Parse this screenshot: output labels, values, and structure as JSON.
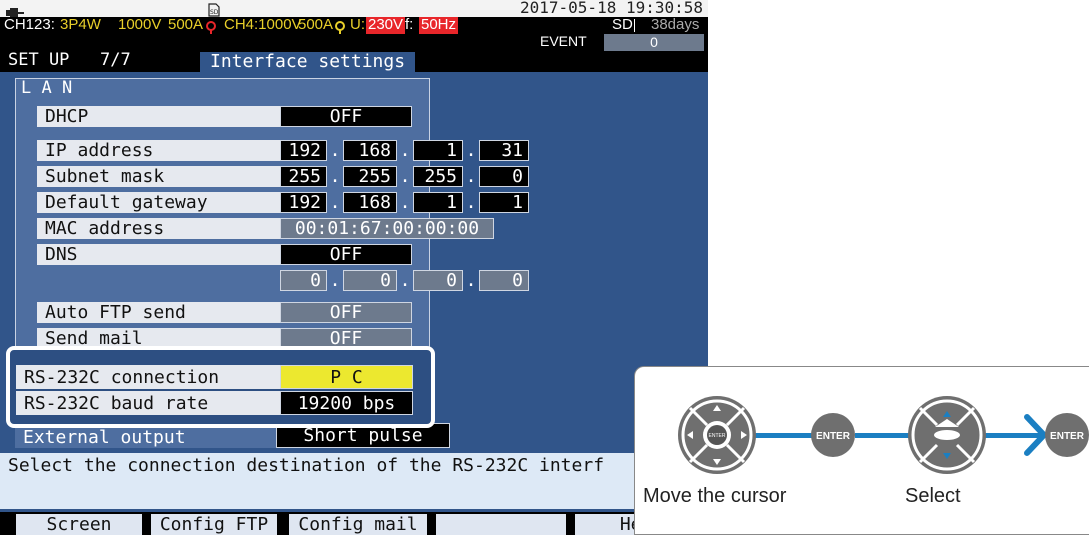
{
  "status": {
    "datetime": "2017-05-18 19:30:58",
    "ch123": "CH123:",
    "wiring": "3P4W",
    "voltage_range": "1000V",
    "current_range": "500A",
    "ch4": "CH4:1000V",
    "ch4_current": "500A",
    "u_label": "U:",
    "u_value": "230V",
    "f_label": "f:",
    "f_value": "50Hz",
    "sd": "SD",
    "days": "38days",
    "event": "EVENT",
    "event_count": "0",
    "colors": {
      "accent_red": "#e8262a",
      "warning_yellow": "#e8cf2a"
    }
  },
  "title": {
    "menu": "SET UP",
    "page": "7/7",
    "name": "Interface settings"
  },
  "lan": {
    "header": "L A N",
    "dhcp": {
      "label": "DHCP",
      "value": "OFF"
    },
    "ip": {
      "label": "IP address",
      "octets": [
        "192",
        "168",
        "1",
        "31"
      ]
    },
    "subnet": {
      "label": "Subnet mask",
      "octets": [
        "255",
        "255",
        "255",
        "0"
      ]
    },
    "gateway": {
      "label": "Default gateway",
      "octets": [
        "192",
        "168",
        "1",
        "1"
      ]
    },
    "mac": {
      "label": "MAC address",
      "value": "00:01:67:00:00:00"
    },
    "dns": {
      "label": "DNS",
      "value": "OFF",
      "octets": [
        "0",
        "0",
        "0",
        "0"
      ]
    },
    "ftp": {
      "label": "Auto FTP send",
      "value": "OFF"
    },
    "mail": {
      "label": "Send mail",
      "value": "OFF"
    }
  },
  "rs232": {
    "connection": {
      "label": "RS-232C connection",
      "value": "P C"
    },
    "baud": {
      "label": "RS-232C baud rate",
      "value": "19200 bps"
    }
  },
  "external": {
    "label": "External output",
    "value": "Short pulse"
  },
  "message": "Select the connection destination of the RS-232C interf",
  "fkeys": [
    "Screen",
    "Config FTP",
    "Config mail",
    "",
    "Help"
  ],
  "instructions": {
    "enter": "ENTER",
    "move": "Move the cursor",
    "select": "Select"
  }
}
